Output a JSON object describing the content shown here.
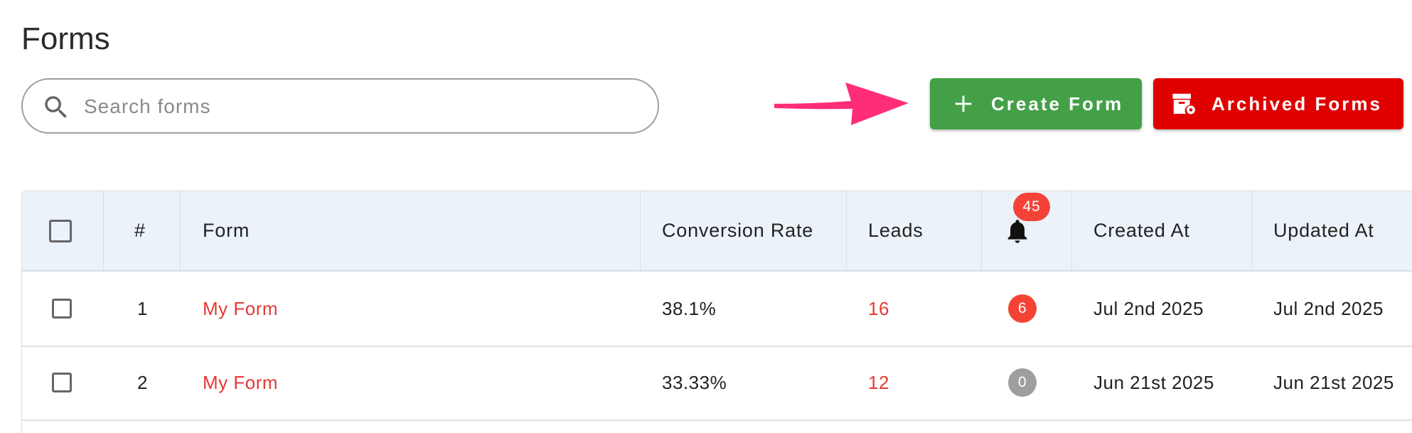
{
  "page": {
    "title": "Forms"
  },
  "search": {
    "placeholder": "Search forms",
    "value": ""
  },
  "toolbar": {
    "create_label": "Create Form",
    "archived_label": "Archived Forms"
  },
  "colors": {
    "create_button": "#43a047",
    "archived_button": "#e00000",
    "annotation_arrow": "#ff2d78",
    "header_bg": "#ebf2f9",
    "link": "#e53935",
    "notification_badge": "#f44336",
    "zero_badge": "#9e9e9e"
  },
  "table": {
    "headers": {
      "index": "#",
      "form": "Form",
      "conversion_rate": "Conversion Rate",
      "leads": "Leads",
      "notifications_icon": "bell-icon",
      "notifications_total": "45",
      "created_at": "Created At",
      "updated_at": "Updated At"
    },
    "rows": [
      {
        "index": "1",
        "form": "My Form",
        "conversion_rate": "38.1%",
        "leads": "16",
        "notifications": "6",
        "created_at": "Jul 2nd 2025",
        "updated_at": "Jul 2nd 2025"
      },
      {
        "index": "2",
        "form": "My Form",
        "conversion_rate": "33.33%",
        "leads": "12",
        "notifications": "0",
        "created_at": "Jun 21st 2025",
        "updated_at": "Jun 21st 2025"
      }
    ]
  }
}
